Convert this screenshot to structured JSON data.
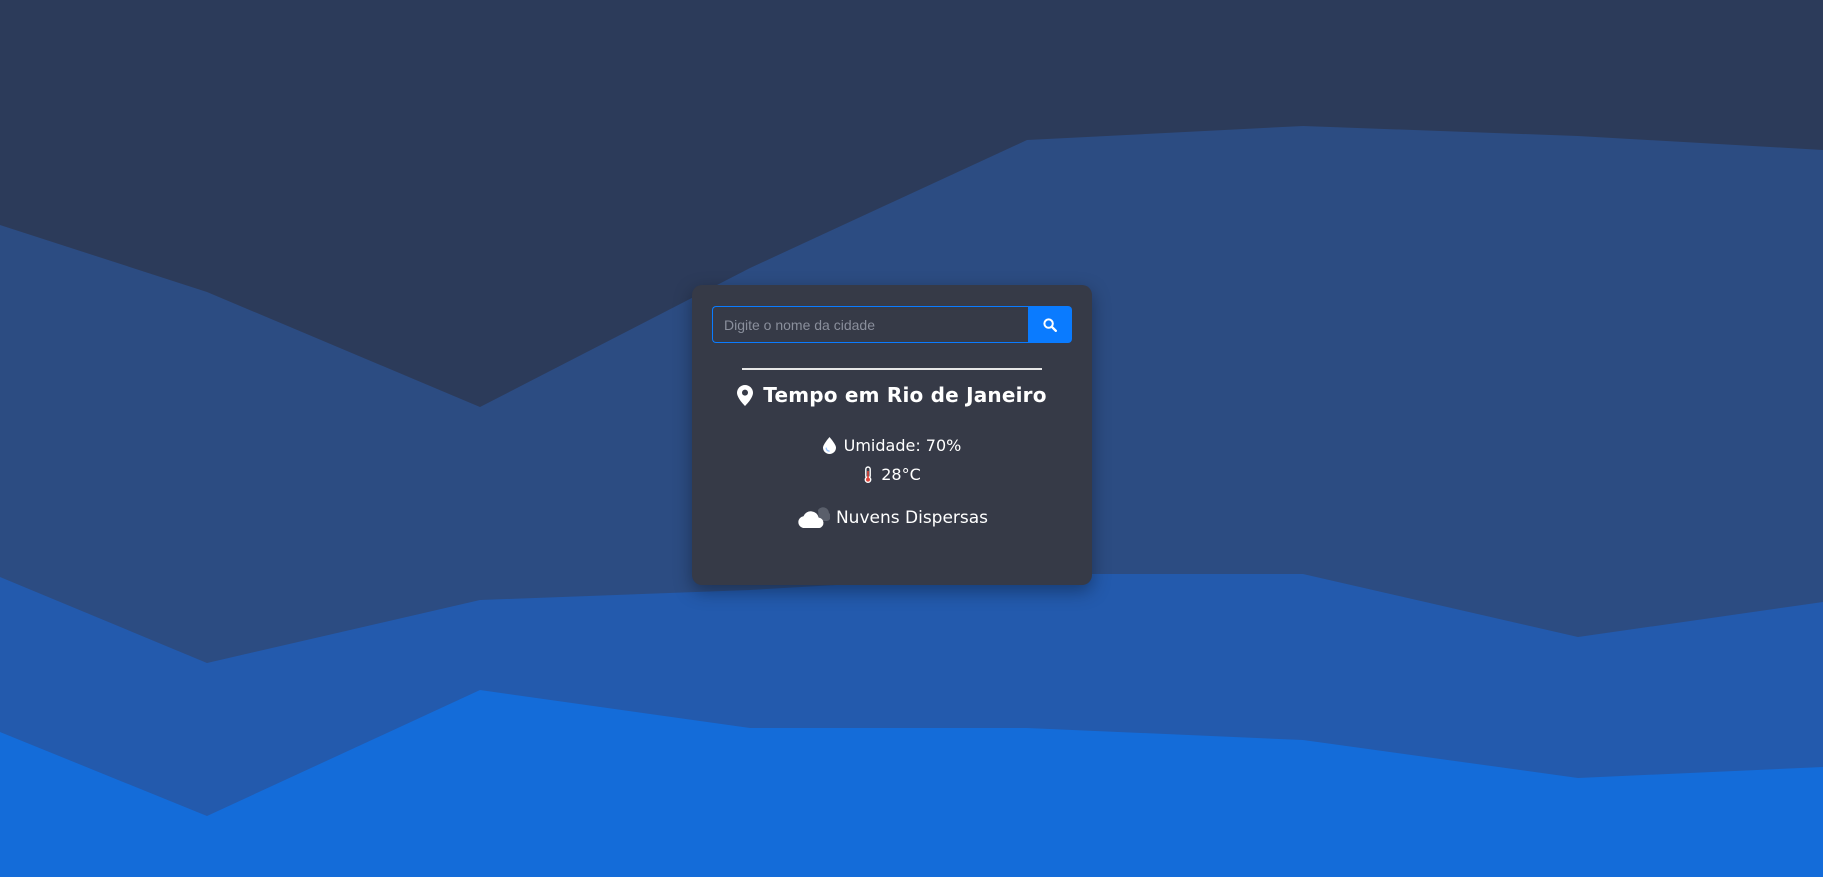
{
  "search": {
    "placeholder": "Digite o nome da cidade",
    "button_icon": "search-icon"
  },
  "weather": {
    "location_icon": "map-pin-icon",
    "title": "Tempo em Rio de Janeiro",
    "humidity_icon": "water-drop-icon",
    "humidity": "Umidade: 70%",
    "temperature_icon": "thermometer-icon",
    "temperature": "28°C",
    "condition_icon": "cloud-icon",
    "description": "Nuvens Dispersas"
  },
  "colors": {
    "card_background": "#363a47",
    "accent": "#0a7bff",
    "text": "#ffffff"
  }
}
